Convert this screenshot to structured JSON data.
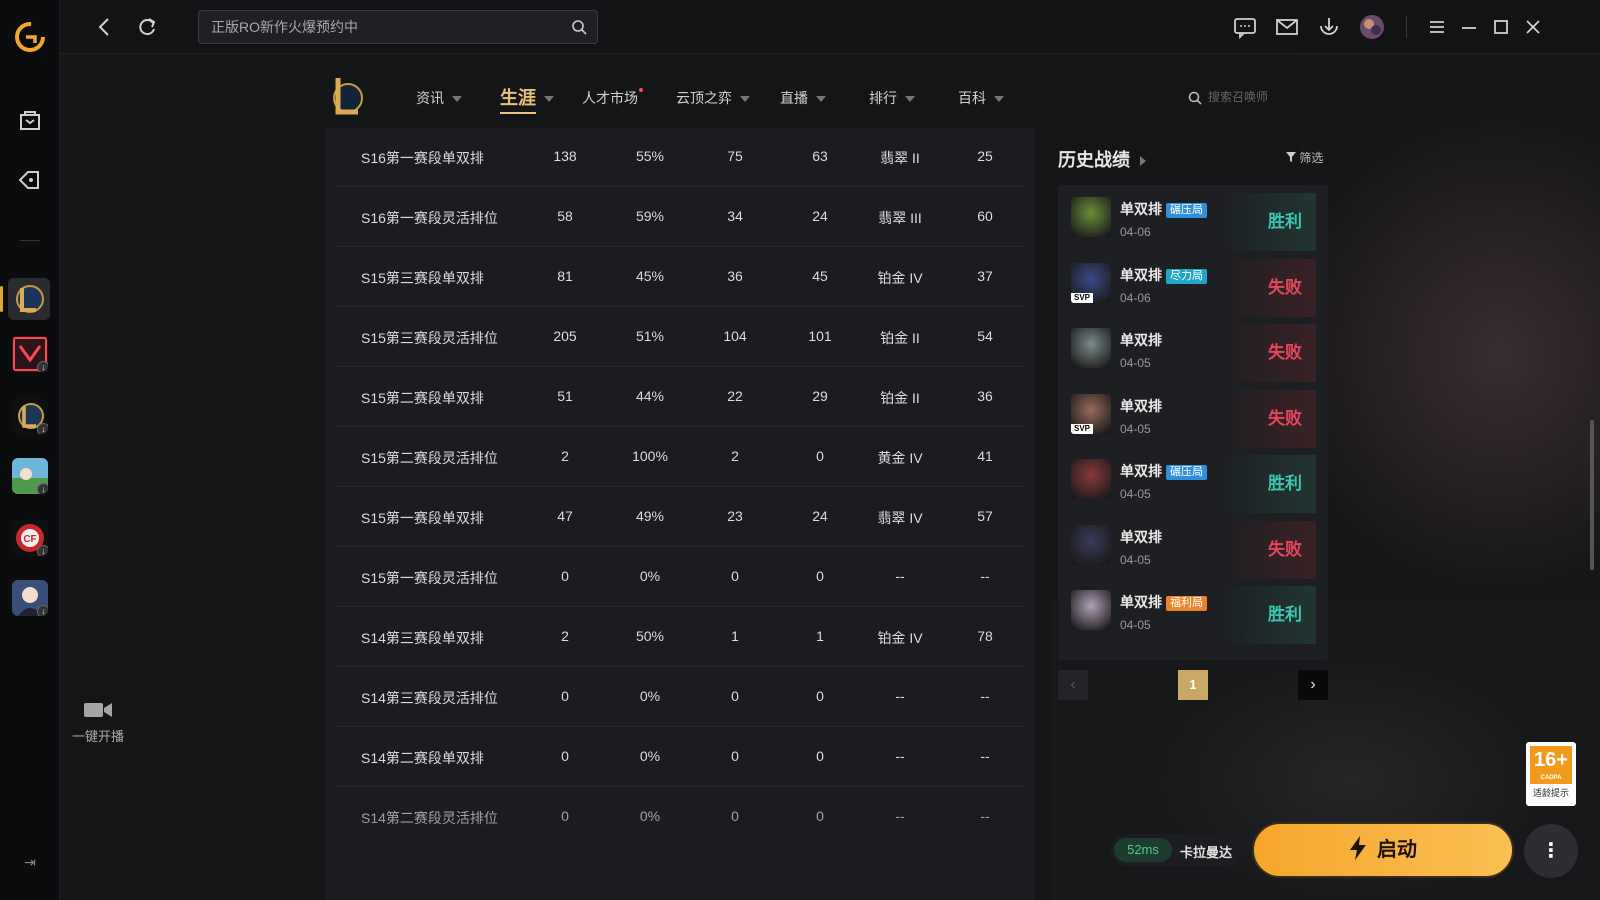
{
  "topbar": {
    "search_placeholder": "正版RO新作火爆预约中"
  },
  "rail": {
    "live_label": "一键开播"
  },
  "game_nav": {
    "items": [
      {
        "label": "资讯"
      },
      {
        "label": "生涯"
      },
      {
        "label": "人才市场"
      },
      {
        "label": "云顶之弈"
      },
      {
        "label": "直播"
      },
      {
        "label": "排行"
      },
      {
        "label": "百科"
      }
    ],
    "active": "生涯",
    "summoner_search_placeholder": "搜索召唤师"
  },
  "ranked_table": {
    "rows": [
      {
        "season": "S16第一赛段单双排",
        "games": "138",
        "winrate": "55%",
        "wins": "75",
        "losses": "63",
        "rank": "翡翠 II",
        "score": "25"
      },
      {
        "season": "S16第一赛段灵活排位",
        "games": "58",
        "winrate": "59%",
        "wins": "34",
        "losses": "24",
        "rank": "翡翠 III",
        "score": "60"
      },
      {
        "season": "S15第三赛段单双排",
        "games": "81",
        "winrate": "45%",
        "wins": "36",
        "losses": "45",
        "rank": "铂金 IV",
        "score": "37"
      },
      {
        "season": "S15第三赛段灵活排位",
        "games": "205",
        "winrate": "51%",
        "wins": "104",
        "losses": "101",
        "rank": "铂金 II",
        "score": "54"
      },
      {
        "season": "S15第二赛段单双排",
        "games": "51",
        "winrate": "44%",
        "wins": "22",
        "losses": "29",
        "rank": "铂金 II",
        "score": "36"
      },
      {
        "season": "S15第二赛段灵活排位",
        "games": "2",
        "winrate": "100%",
        "wins": "2",
        "losses": "0",
        "rank": "黄金 IV",
        "score": "41"
      },
      {
        "season": "S15第一赛段单双排",
        "games": "47",
        "winrate": "49%",
        "wins": "23",
        "losses": "24",
        "rank": "翡翠 IV",
        "score": "57"
      },
      {
        "season": "S15第一赛段灵活排位",
        "games": "0",
        "winrate": "0%",
        "wins": "0",
        "losses": "0",
        "rank": "--",
        "score": "--"
      },
      {
        "season": "S14第三赛段单双排",
        "games": "2",
        "winrate": "50%",
        "wins": "1",
        "losses": "1",
        "rank": "铂金 IV",
        "score": "78"
      },
      {
        "season": "S14第三赛段灵活排位",
        "games": "0",
        "winrate": "0%",
        "wins": "0",
        "losses": "0",
        "rank": "--",
        "score": "--"
      },
      {
        "season": "S14第二赛段单双排",
        "games": "0",
        "winrate": "0%",
        "wins": "0",
        "losses": "0",
        "rank": "--",
        "score": "--"
      },
      {
        "season": "S14第二赛段灵活排位",
        "games": "0",
        "winrate": "0%",
        "wins": "0",
        "losses": "0",
        "rank": "--",
        "score": "--"
      }
    ]
  },
  "history": {
    "title": "历史战绩",
    "filter_label": "筛选",
    "matches": [
      {
        "mode": "单双排",
        "tag": "碾压局",
        "tag_color": "#2f8fd8",
        "date": "04-06",
        "result": "胜利",
        "win": true,
        "svp": false,
        "champ_color": "#6a8f3a"
      },
      {
        "mode": "单双排",
        "tag": "尽力局",
        "tag_color": "#20a7c7",
        "date": "04-06",
        "result": "失败",
        "win": false,
        "svp": true,
        "svp_label": "SVP",
        "champ_color": "#3a4a8a"
      },
      {
        "mode": "单双排",
        "tag": "",
        "tag_color": "",
        "date": "04-05",
        "result": "失败",
        "win": false,
        "svp": false,
        "champ_color": "#7a8a8a"
      },
      {
        "mode": "单双排",
        "tag": "",
        "tag_color": "",
        "date": "04-05",
        "result": "失败",
        "win": false,
        "svp": true,
        "svp_label": "SVP",
        "champ_color": "#9a6a5a"
      },
      {
        "mode": "单双排",
        "tag": "碾压局",
        "tag_color": "#2f8fd8",
        "date": "04-05",
        "result": "胜利",
        "win": true,
        "svp": false,
        "champ_color": "#8a3a3a"
      },
      {
        "mode": "单双排",
        "tag": "",
        "tag_color": "",
        "date": "04-05",
        "result": "失败",
        "win": false,
        "svp": false,
        "champ_color": "#3a3a5a"
      },
      {
        "mode": "单双排",
        "tag": "福利局",
        "tag_color": "#e8842a",
        "date": "04-05",
        "result": "胜利",
        "win": true,
        "svp": false,
        "champ_color": "#b0a0b8"
      }
    ],
    "page": "1"
  },
  "footer": {
    "ping": "52ms",
    "server": "卡拉曼达",
    "launch_label": "启动",
    "age_rating": "16+",
    "age_org": "CADPA",
    "age_tip": "适龄提示"
  },
  "colors": {
    "accent_gold": "#e8c278",
    "launch_orange": "#f5a62d",
    "win_teal": "#3cc6b1",
    "lose_red": "#e4465a"
  }
}
